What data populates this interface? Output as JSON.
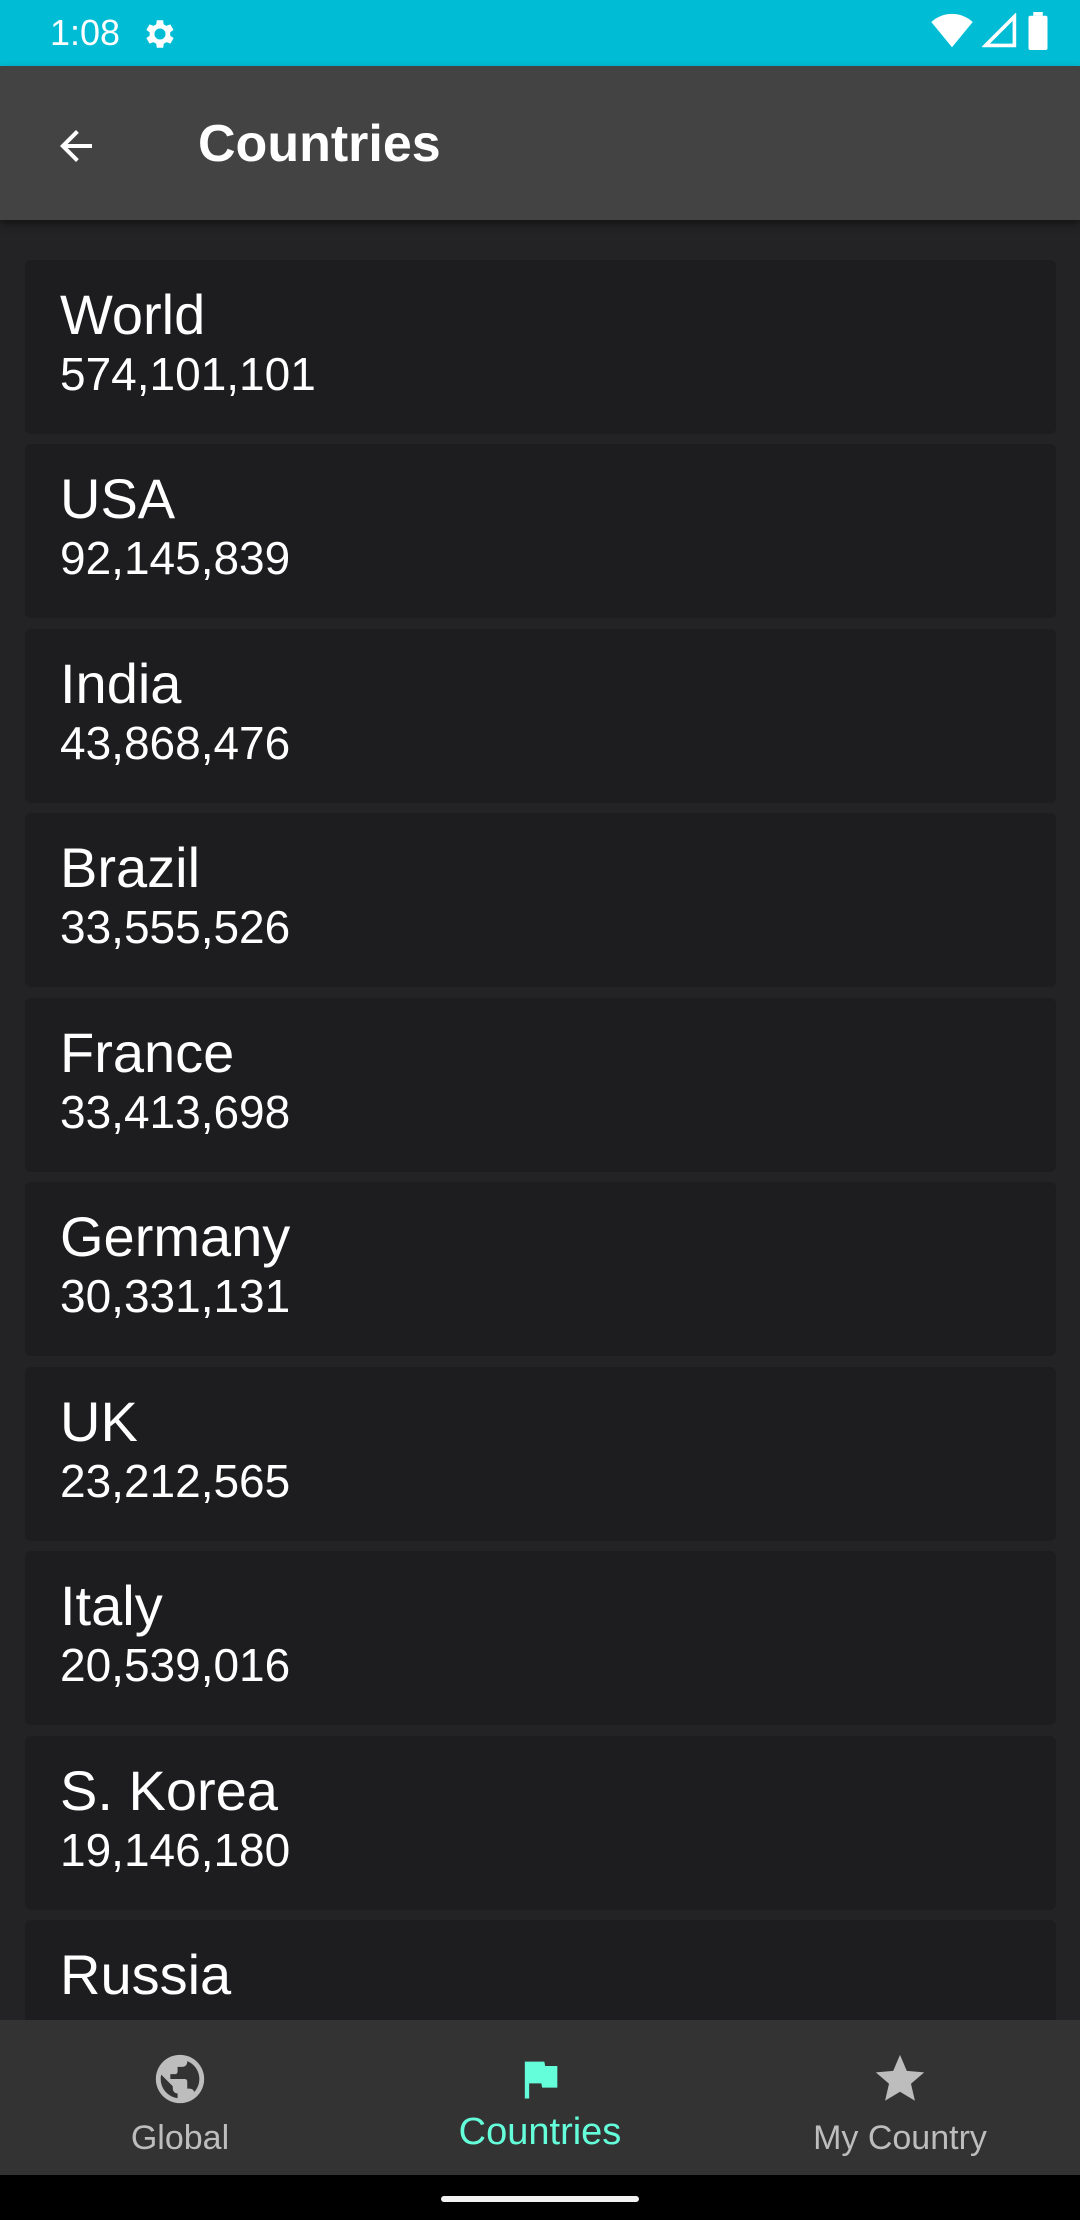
{
  "status_bar": {
    "time": "1:08",
    "background_color": "#00bcd4",
    "icons": [
      "gear-icon",
      "wifi-icon",
      "signal-icon",
      "battery-icon"
    ]
  },
  "app_bar": {
    "title": "Countries",
    "back_icon": "arrow-back-icon",
    "background_color": "#434343"
  },
  "countries": [
    {
      "name": "World",
      "cases": "574,101,101"
    },
    {
      "name": "USA",
      "cases": "92,145,839"
    },
    {
      "name": "India",
      "cases": "43,868,476"
    },
    {
      "name": "Brazil",
      "cases": "33,555,526"
    },
    {
      "name": "France",
      "cases": "33,413,698"
    },
    {
      "name": "Germany",
      "cases": "30,331,131"
    },
    {
      "name": "UK",
      "cases": "23,212,565"
    },
    {
      "name": "Italy",
      "cases": "20,539,016"
    },
    {
      "name": "S. Korea",
      "cases": "19,146,180"
    },
    {
      "name": "Russia",
      "cases": ""
    }
  ],
  "bottom_nav": {
    "items": [
      {
        "label": "Global",
        "icon": "globe-icon",
        "active": false
      },
      {
        "label": "Countries",
        "icon": "flag-icon",
        "active": true
      },
      {
        "label": "My Country",
        "icon": "star-icon",
        "active": false
      }
    ],
    "active_color": "#64ffda",
    "inactive_color": "#bdbdbd"
  }
}
